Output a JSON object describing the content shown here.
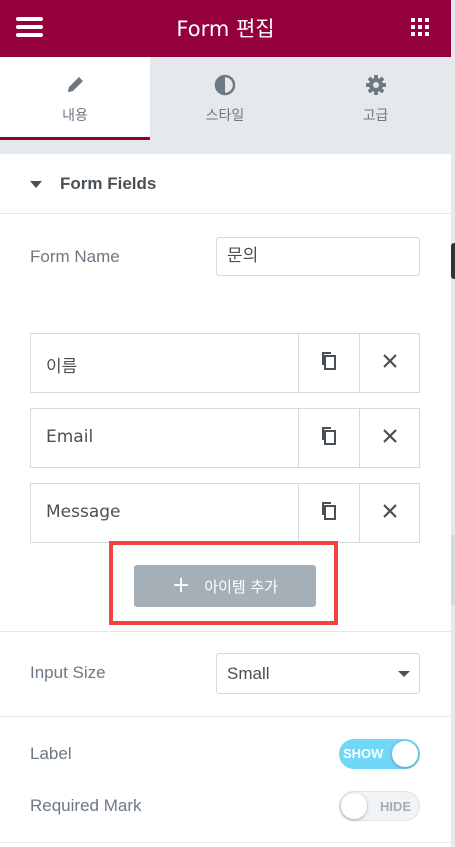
{
  "header": {
    "title": "Form 편집"
  },
  "tabs": [
    {
      "label": "내용",
      "icon": "pencil-icon"
    },
    {
      "label": "스타일",
      "icon": "contrast-icon"
    },
    {
      "label": "고급",
      "icon": "gear-icon"
    }
  ],
  "section": {
    "title": "Form Fields"
  },
  "form_name": {
    "label": "Form Name",
    "value": "문의"
  },
  "fields": [
    {
      "title": "이름"
    },
    {
      "title": "Email"
    },
    {
      "title": "Message"
    }
  ],
  "add_item": {
    "label": "아이템 추가",
    "plus": "+"
  },
  "input_size": {
    "label": "Input Size",
    "value": "Small"
  },
  "label_toggle": {
    "label": "Label",
    "state": "SHOW"
  },
  "required_mark": {
    "label": "Required Mark",
    "state": "HIDE"
  },
  "colors": {
    "brand": "#93003c",
    "highlight": "#ef4442",
    "toggle_on": "#71d7f7"
  }
}
